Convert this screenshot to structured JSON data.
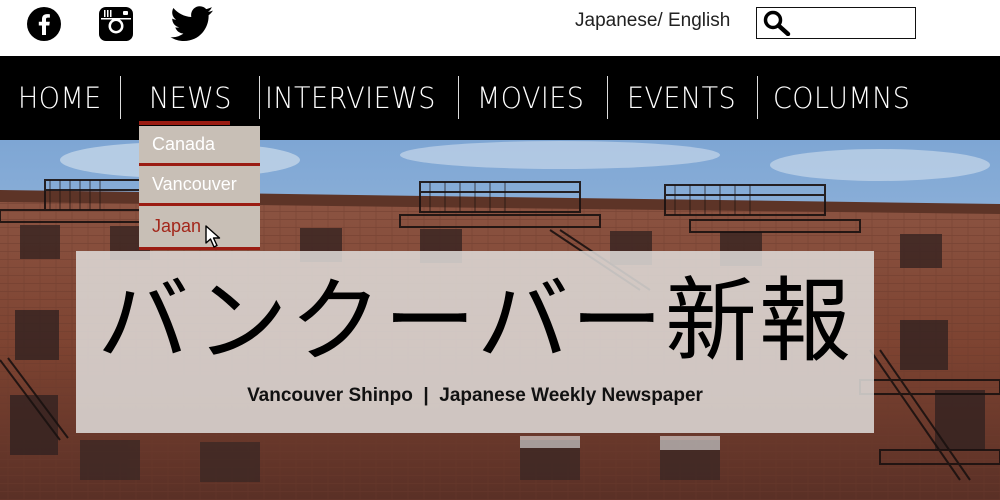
{
  "social": {
    "facebook_icon": "facebook-icon",
    "instagram_icon": "instagram-icon",
    "twitter_icon": "twitter-icon"
  },
  "language_toggle": "Japanese/ English",
  "search": {
    "placeholder": "",
    "icon": "search-icon"
  },
  "nav": {
    "items": [
      {
        "label": "HOME"
      },
      {
        "label": "NEWS"
      },
      {
        "label": "INTERVIEWS"
      },
      {
        "label": "MOVIES"
      },
      {
        "label": "EVENTS"
      },
      {
        "label": "COLUMNS"
      }
    ]
  },
  "news_dropdown": {
    "items": [
      {
        "label": "Canada"
      },
      {
        "label": "Vancouver"
      },
      {
        "label": "Japan"
      }
    ],
    "hovered": "Japan"
  },
  "hero": {
    "title": "バンクーバー新報",
    "subtitle": "Vancouver Shinpo  |  Japanese Weekly Newspaper"
  },
  "colors": {
    "nav_background": "#000000",
    "accent": "#9b1c12",
    "dropdown_background": "#c8bfb6",
    "dropdown_active_text": "#a3271b"
  }
}
